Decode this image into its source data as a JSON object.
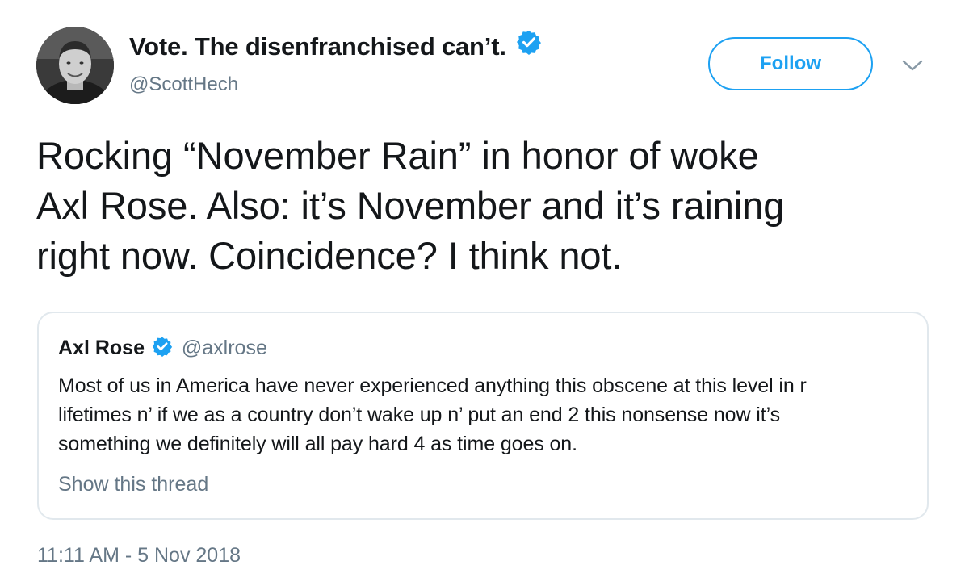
{
  "tweet": {
    "author": {
      "display_name": "Vote. The disenfranchised can’t.",
      "handle": "@ScottHech",
      "verified": true
    },
    "follow_label": "Follow",
    "text_lines": [
      "Rocking “November Rain” in honor of woke",
      "Axl Rose. Also: it’s November and it’s raining",
      "right now. Coincidence? I think not."
    ],
    "timestamp": "11:11 AM - 5 Nov 2018"
  },
  "quoted": {
    "name": "Axl Rose",
    "handle": "@axlrose",
    "verified": true,
    "text_lines": [
      "Most of us in America have never experienced anything this obscene at this level in r",
      "lifetimes n’ if we as a country don’t wake up n’ put an end 2 this nonsense now it’s",
      "something we definitely will all pay hard 4 as time goes on."
    ],
    "show_thread_label": "Show this thread"
  },
  "colors": {
    "accent": "#1da1f2",
    "text": "#14171a",
    "secondary": "#657786",
    "border": "#e1e8ed"
  },
  "icons": [
    "avatar",
    "verified-badge-icon",
    "chevron-down-icon"
  ]
}
